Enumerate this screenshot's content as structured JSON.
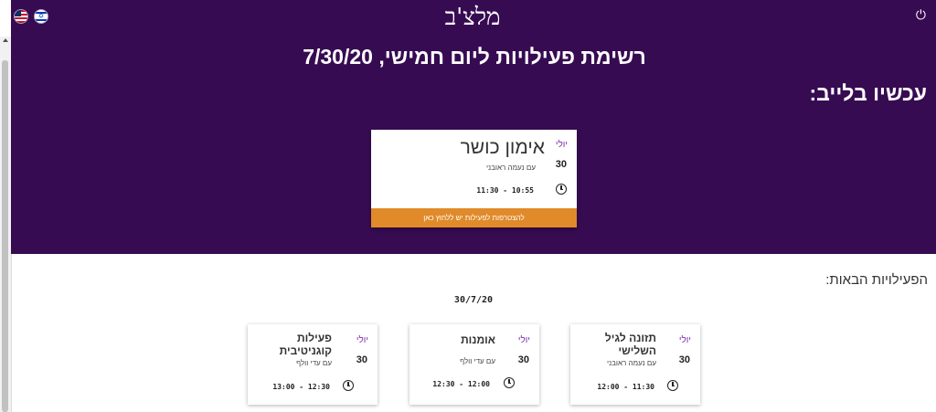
{
  "header": {
    "logo": "מלצ'ב",
    "languages": [
      "English",
      "עברית"
    ]
  },
  "hero": {
    "title": "רשימת פעילויות ליום חמישי, 7/30/20",
    "live_heading": "עכשיו בלייב:",
    "live_card": {
      "month": "יולי",
      "day": "30",
      "title": "אימון כושר",
      "instructor": "עם נעמה ראובני",
      "time": "11:30 - 10:55",
      "join_label": "להצטרפות לפעילות יש ללחוץ כאן"
    }
  },
  "upcoming": {
    "heading": "הפעילויות הבאות:",
    "date": "30/7/20",
    "cards": [
      {
        "month": "יולי",
        "day": "30",
        "title": "פעילות קוגניטיבית",
        "instructor": "עם עדי וולף",
        "time": "13:00 - 12:30"
      },
      {
        "month": "יולי",
        "day": "30",
        "title": "אומנות",
        "instructor": "עם עדי וולף",
        "time": "12:30 - 12:00"
      },
      {
        "month": "יולי",
        "day": "30",
        "title": "תזונה לגיל השלישי",
        "instructor": "עם נעמה ראובני",
        "time": "12:00 - 11:30"
      }
    ]
  },
  "colors": {
    "hero_background": "#370b52",
    "accent_orange": "#e08a2a",
    "month_purple": "#7b2ea8"
  },
  "icons": [
    "us-flag-icon",
    "israel-flag-icon",
    "power-icon",
    "clock-icon"
  ]
}
